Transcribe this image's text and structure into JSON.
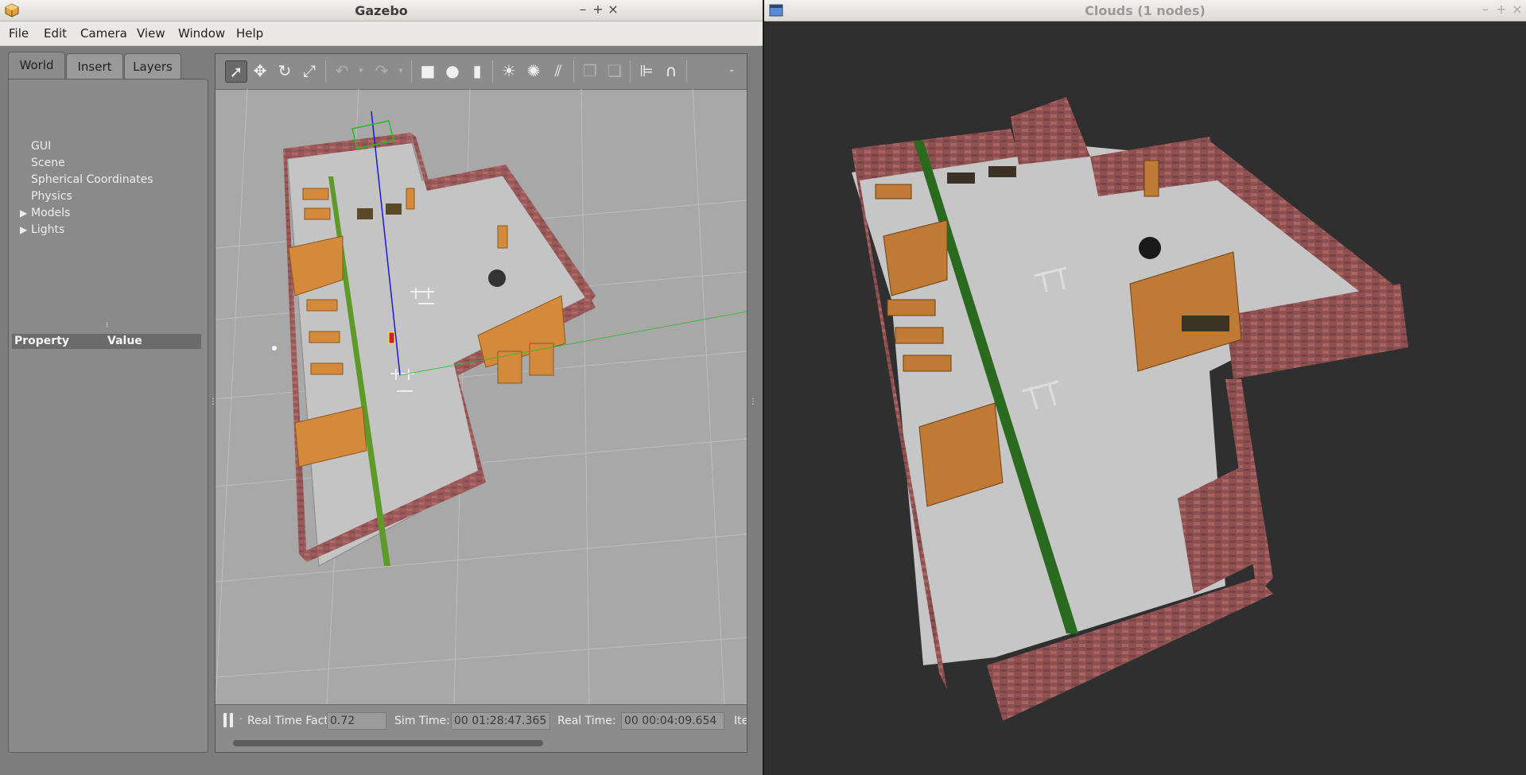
{
  "gazebo": {
    "title": "Gazebo",
    "controls": {
      "minimize": "–",
      "maximize": "+",
      "close": "×"
    },
    "menu": [
      "File",
      "Edit",
      "Camera",
      "View",
      "Window",
      "Help"
    ],
    "tabs": [
      "World",
      "Insert",
      "Layers"
    ],
    "tree": [
      {
        "label": "GUI",
        "expandable": false
      },
      {
        "label": "Scene",
        "expandable": false
      },
      {
        "label": "Spherical Coordinates",
        "expandable": false
      },
      {
        "label": "Physics",
        "expandable": false
      },
      {
        "label": "Models",
        "expandable": true
      },
      {
        "label": "Lights",
        "expandable": true
      }
    ],
    "properties": {
      "col_property": "Property",
      "col_value": "Value"
    },
    "toolbar_icons": [
      "select-arrow-icon",
      "translate-icon",
      "rotate-icon",
      "scale-icon",
      "undo-icon",
      "undo-dropdown-icon",
      "redo-icon",
      "redo-dropdown-icon",
      "box-icon",
      "sphere-icon",
      "cylinder-icon",
      "point-light-icon",
      "spot-light-icon",
      "directional-light-icon",
      "copy-icon",
      "paste-icon",
      "align-icon",
      "snap-icon",
      "more-icon"
    ],
    "status": {
      "real_time_factor_label": "Real Time Factor:",
      "real_time_factor": "0.72",
      "sim_time_label": "Sim Time:",
      "sim_time": "00 01:28:47.365",
      "real_time_label": "Real Time:",
      "real_time": "00 00:04:09.654",
      "iterations_label": "Ite"
    }
  },
  "clouds": {
    "title": "Clouds (1 nodes)",
    "controls": {
      "minimize": "–",
      "maximize": "+",
      "close": "×"
    }
  }
}
